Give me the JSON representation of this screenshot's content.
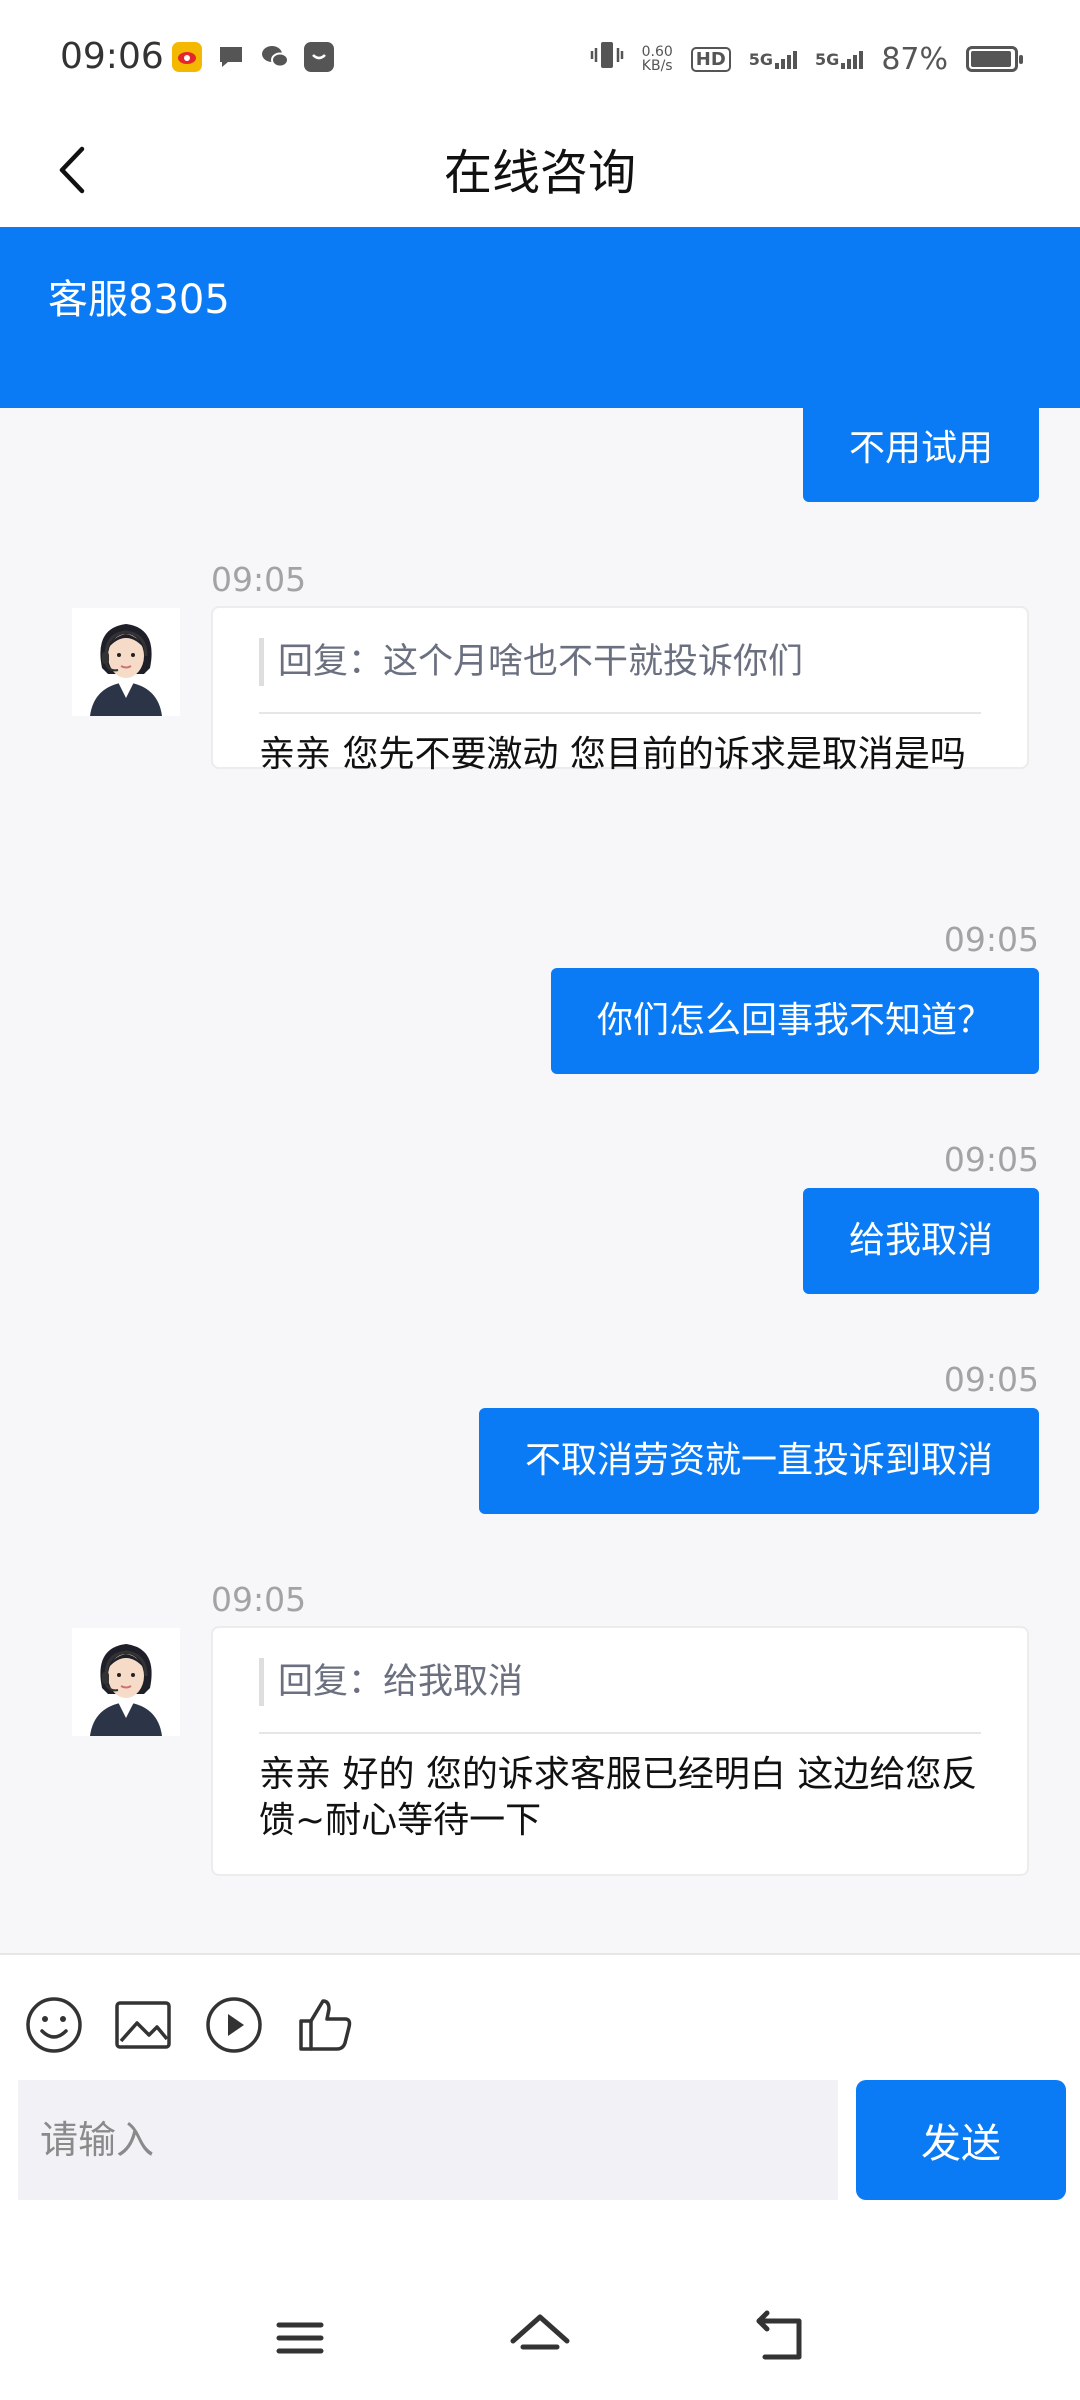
{
  "status_bar": {
    "time": "09:06",
    "net_speed_value": "0.60",
    "net_speed_unit": "KB/s",
    "hd_label": "HD",
    "signal1": "5G",
    "signal2": "5G",
    "battery": "87%",
    "battery_level": 0.87,
    "notification_icons": [
      "weibo-icon",
      "message-icon",
      "wechat-icon",
      "shopping-bag-icon"
    ]
  },
  "header": {
    "title": "在线咨询",
    "back_icon": "chevron-left-icon"
  },
  "agent": {
    "name": "客服8305"
  },
  "messages": [
    {
      "side": "right",
      "text": "不用试用"
    },
    {
      "side": "left",
      "time": "09:05",
      "quote": "回复：这个月啥也不干就投诉你们",
      "text": "亲亲 您先不要激动 您目前的诉求是取消是吗"
    },
    {
      "side": "right",
      "time": "09:05",
      "text": "你们怎么回事我不知道？"
    },
    {
      "side": "right",
      "time": "09:05",
      "text": "给我取消"
    },
    {
      "side": "right",
      "time": "09:05",
      "text": "不取消劳资就一直投诉到取消"
    },
    {
      "side": "left",
      "time": "09:05",
      "quote": "回复：给我取消",
      "text": "亲亲 好的 您的诉求客服已经明白 这边给您反馈~耐心等待一下"
    }
  ],
  "toolbar": {
    "icons": [
      "emoji-icon",
      "image-icon",
      "video-icon",
      "thumbs-up-icon"
    ]
  },
  "composer": {
    "placeholder": "请输入",
    "send_label": "发送"
  },
  "nav": {
    "icons": [
      "menu-icon",
      "home-icon",
      "back-icon"
    ]
  },
  "colors": {
    "accent": "#0a7bf5",
    "background": "#f7f7f9"
  }
}
